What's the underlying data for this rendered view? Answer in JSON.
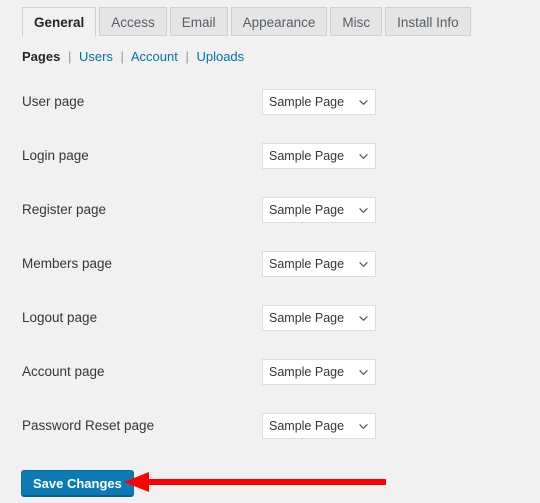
{
  "colors": {
    "page_background": "#f1f1f1",
    "tab_inactive_background": "#e5e5e5",
    "tab_border": "#cfcfcf",
    "link": "#0073aa",
    "button_background": "#0c7bb3",
    "button_text": "#ffffff",
    "annotation_arrow": "#ff0000",
    "select_border": "#dddddd",
    "select_background": "#ffffff",
    "text": "#32373c"
  },
  "tabs": [
    {
      "label": "General",
      "active": true
    },
    {
      "label": "Access",
      "active": false
    },
    {
      "label": "Email",
      "active": false
    },
    {
      "label": "Appearance",
      "active": false
    },
    {
      "label": "Misc",
      "active": false
    },
    {
      "label": "Install Info",
      "active": false
    }
  ],
  "subnav": {
    "current": "Pages",
    "separator": "|",
    "links": [
      "Users",
      "Account",
      "Uploads"
    ]
  },
  "form": {
    "rows": [
      {
        "label": "User page",
        "value": "Sample Page"
      },
      {
        "label": "Login page",
        "value": "Sample Page"
      },
      {
        "label": "Register page",
        "value": "Sample Page"
      },
      {
        "label": "Members page",
        "value": "Sample Page"
      },
      {
        "label": "Logout page",
        "value": "Sample Page"
      },
      {
        "label": "Account page",
        "value": "Sample Page"
      },
      {
        "label": "Password Reset page",
        "value": "Sample Page"
      }
    ]
  },
  "actions": {
    "save_label": "Save Changes"
  },
  "annotation": {
    "type": "left-pointing-arrow",
    "color": "#ff0000",
    "points_to": "Save Changes"
  }
}
